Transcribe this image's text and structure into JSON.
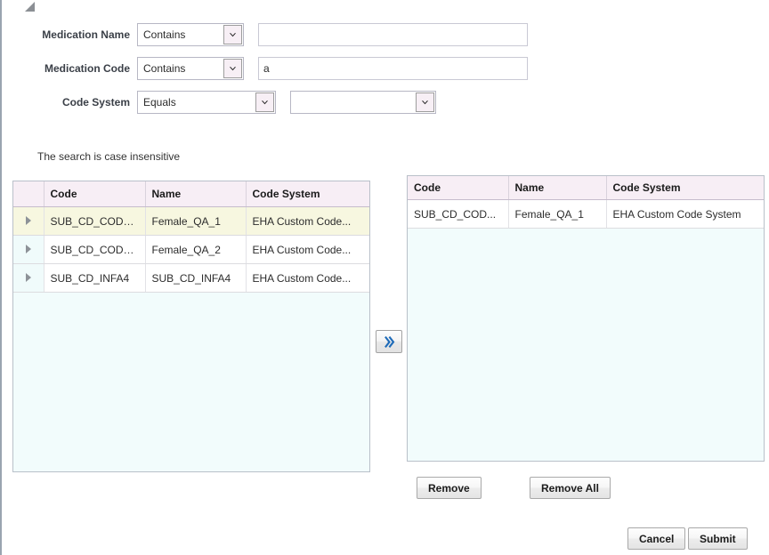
{
  "dialog": {
    "resize_handle_icon": "collapse-triangle-icon"
  },
  "search_form": {
    "rows": [
      {
        "label": "Medication Name",
        "operator": "Contains",
        "operator_icon": "chevron-down-icon",
        "value": "",
        "placeholder": ""
      },
      {
        "label": "Medication Code",
        "operator": "Contains",
        "operator_icon": "chevron-down-icon",
        "value": "a",
        "placeholder": ""
      },
      {
        "label": "Code System",
        "operator": "Equals",
        "operator_icon": "chevron-down-icon",
        "value": "",
        "value_icon": "chevron-down-icon"
      }
    ],
    "hint": "The search is case insensitive"
  },
  "available_table": {
    "expand_icon": "expand-triangle-icon",
    "columns": [
      "Code",
      "Name",
      "Code System"
    ],
    "rows": [
      {
        "code": "SUB_CD_CODE...",
        "name": "Female_QA_1",
        "code_system": "EHA Custom Code...",
        "selected": true
      },
      {
        "code": "SUB_CD_CODE...",
        "name": "Female_QA_2",
        "code_system": "EHA Custom Code...",
        "selected": false
      },
      {
        "code": "SUB_CD_INFA4",
        "name": "SUB_CD_INFA4",
        "code_system": "EHA Custom Code...",
        "selected": false
      }
    ]
  },
  "transfer": {
    "move_right_icon": "double-chevron-right-icon",
    "accent_color": "#1f6bb8"
  },
  "selected_table": {
    "columns": [
      "Code",
      "Name",
      "Code System"
    ],
    "rows": [
      {
        "code": "SUB_CD_COD...",
        "name": "Female_QA_1",
        "code_system": "EHA Custom Code System"
      }
    ]
  },
  "buttons": {
    "remove": "Remove",
    "remove_all": "Remove All",
    "cancel": "Cancel",
    "submit": "Submit"
  }
}
